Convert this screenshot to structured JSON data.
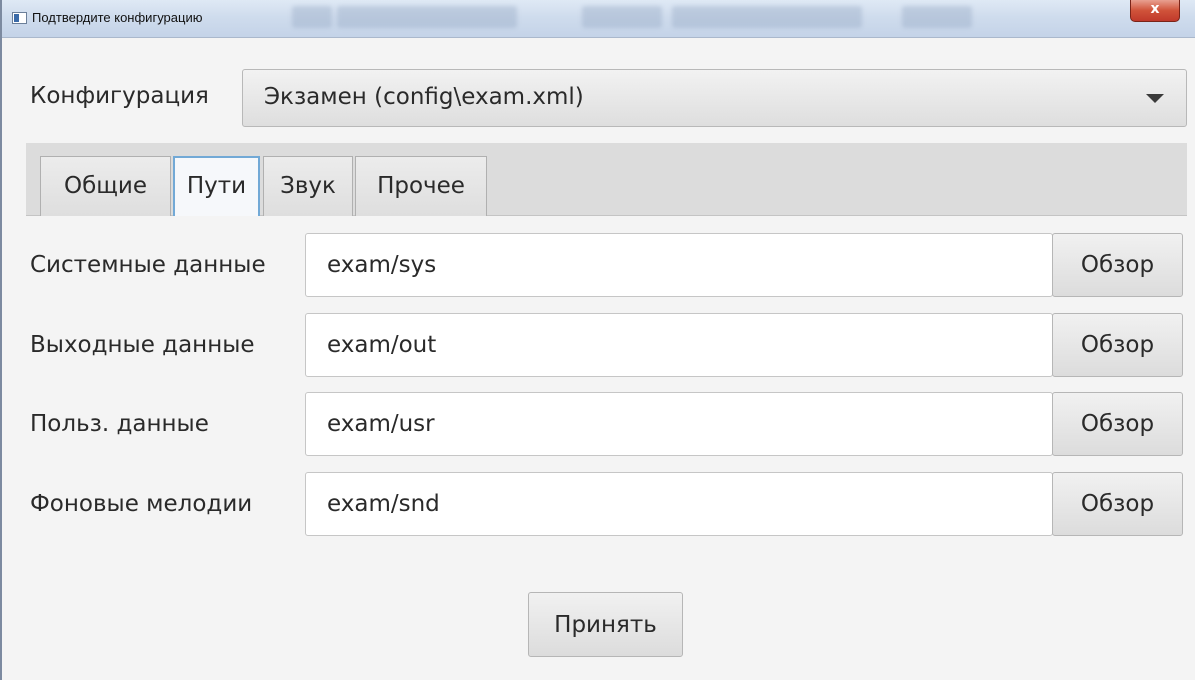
{
  "window": {
    "title": "Подтвердите конфигурацию",
    "close_glyph": "x"
  },
  "config": {
    "label": "Конфигурация",
    "selected": "Экзамен (config\\exam.xml)"
  },
  "tabs": [
    {
      "label": "Общие",
      "active": false
    },
    {
      "label": "Пути",
      "active": true
    },
    {
      "label": "Звук",
      "active": false
    },
    {
      "label": "Прочее",
      "active": false
    }
  ],
  "paths": [
    {
      "label": "Системные данные",
      "value": "exam/sys",
      "button": "Обзор"
    },
    {
      "label": "Выходные данные",
      "value": "exam/out",
      "button": "Обзор"
    },
    {
      "label": "Польз. данные",
      "value": "exam/usr",
      "button": "Обзор"
    },
    {
      "label": "Фоновые мелодии",
      "value": "exam/snd",
      "button": "Обзор"
    }
  ],
  "accept_label": "Принять",
  "colors": {
    "active_tab_border": "#72a9d6",
    "close_button": "#c0392b",
    "titlebar": "#cfdced"
  }
}
